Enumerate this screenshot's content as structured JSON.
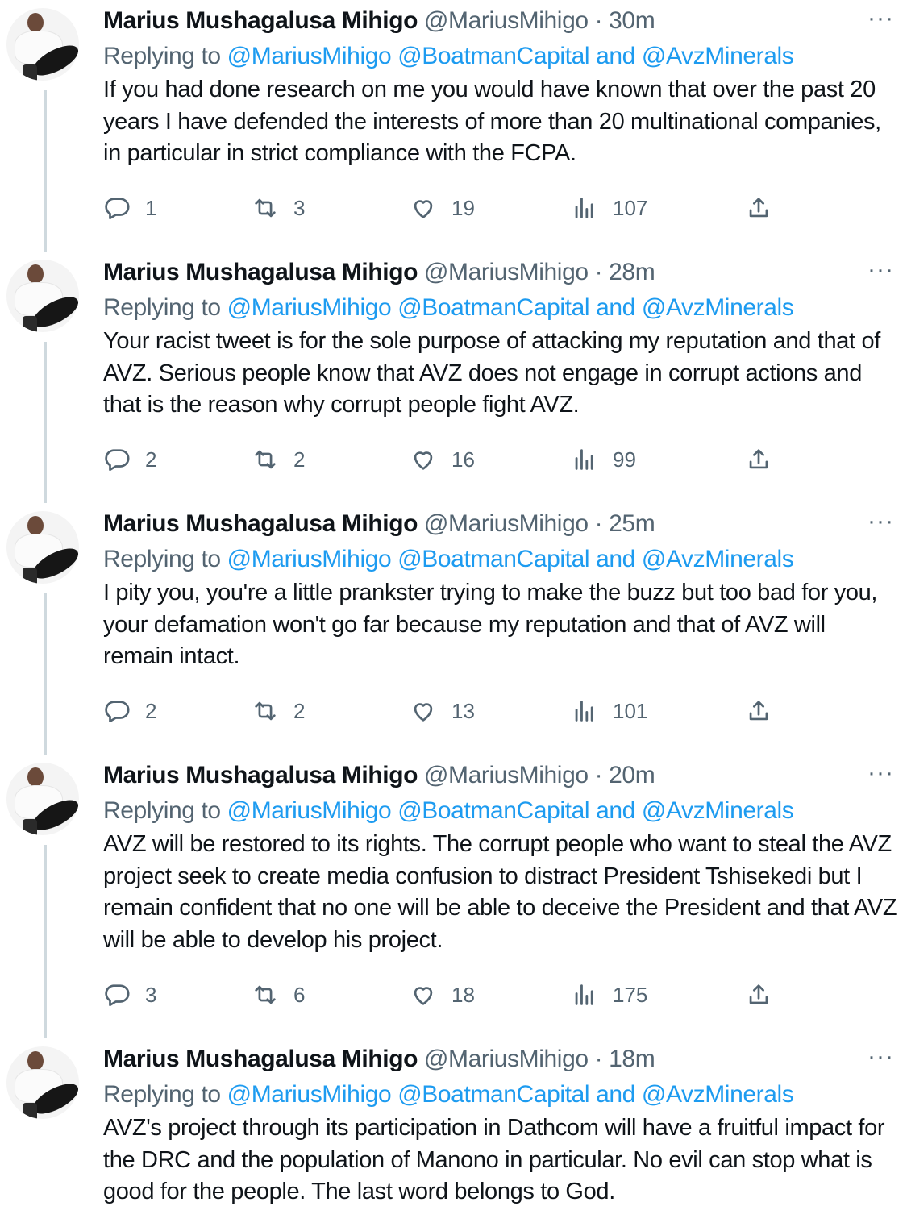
{
  "tweets": [
    {
      "name": "Marius Mushagalusa Mihigo",
      "handle": "@MariusMihigo",
      "separator": "·",
      "time": "30m",
      "replying_prefix": "Replying to",
      "mention1": "@MariusMihigo",
      "mention2": "@BoatmanCapital",
      "and": "and",
      "mention3": "@AvzMinerals",
      "text": "If you had done research on me you would have known that over the past 20 years I have defended the interests of more than 20 multinational companies, in particular in strict compliance with the FCPA.",
      "replies": "1",
      "retweets": "3",
      "likes": "19",
      "views": "107"
    },
    {
      "name": "Marius Mushagalusa Mihigo",
      "handle": "@MariusMihigo",
      "separator": "·",
      "time": "28m",
      "replying_prefix": "Replying to",
      "mention1": "@MariusMihigo",
      "mention2": "@BoatmanCapital",
      "and": "and",
      "mention3": "@AvzMinerals",
      "text": "Your racist tweet is for the sole purpose of attacking my reputation and that of AVZ. Serious people know that AVZ does not engage in corrupt actions and that is the reason why corrupt people fight AVZ.",
      "replies": "2",
      "retweets": "2",
      "likes": "16",
      "views": "99"
    },
    {
      "name": "Marius Mushagalusa Mihigo",
      "handle": "@MariusMihigo",
      "separator": "·",
      "time": "25m",
      "replying_prefix": "Replying to",
      "mention1": "@MariusMihigo",
      "mention2": "@BoatmanCapital",
      "and": "and",
      "mention3": "@AvzMinerals",
      "text": "I pity you, you're a little prankster trying to make the buzz but too bad for you, your defamation won't go far because my reputation and that of AVZ will remain intact.",
      "replies": "2",
      "retweets": "2",
      "likes": "13",
      "views": "101"
    },
    {
      "name": "Marius Mushagalusa Mihigo",
      "handle": "@MariusMihigo",
      "separator": "·",
      "time": "20m",
      "replying_prefix": "Replying to",
      "mention1": "@MariusMihigo",
      "mention2": "@BoatmanCapital",
      "and": "and",
      "mention3": "@AvzMinerals",
      "text": "AVZ will be restored to its rights. The corrupt people who want to steal the AVZ project seek to create media confusion to distract President Tshisekedi but I remain confident that no one will be able to deceive the President and that AVZ will be able to develop his project.",
      "replies": "3",
      "retweets": "6",
      "likes": "18",
      "views": "175"
    },
    {
      "name": "Marius Mushagalusa Mihigo",
      "handle": "@MariusMihigo",
      "separator": "·",
      "time": "18m",
      "replying_prefix": "Replying to",
      "mention1": "@MariusMihigo",
      "mention2": "@BoatmanCapital",
      "and": "and",
      "mention3": "@AvzMinerals",
      "text": "AVZ's project through its participation in Dathcom will have a fruitful impact for the DRC and the population of Manono in particular. No evil can stop what is good for the people. The last word belongs to God."
    }
  ],
  "more_icon": "···",
  "icons": {
    "reply": "reply-bubble-icon",
    "retweet": "retweet-icon",
    "like": "heart-icon",
    "views": "views-chart-icon",
    "share": "share-upload-icon"
  },
  "colors": {
    "link": "#1d9bf0",
    "secondary": "#536471",
    "primary_text": "#0f1419",
    "thread_line": "#cfd9de"
  }
}
